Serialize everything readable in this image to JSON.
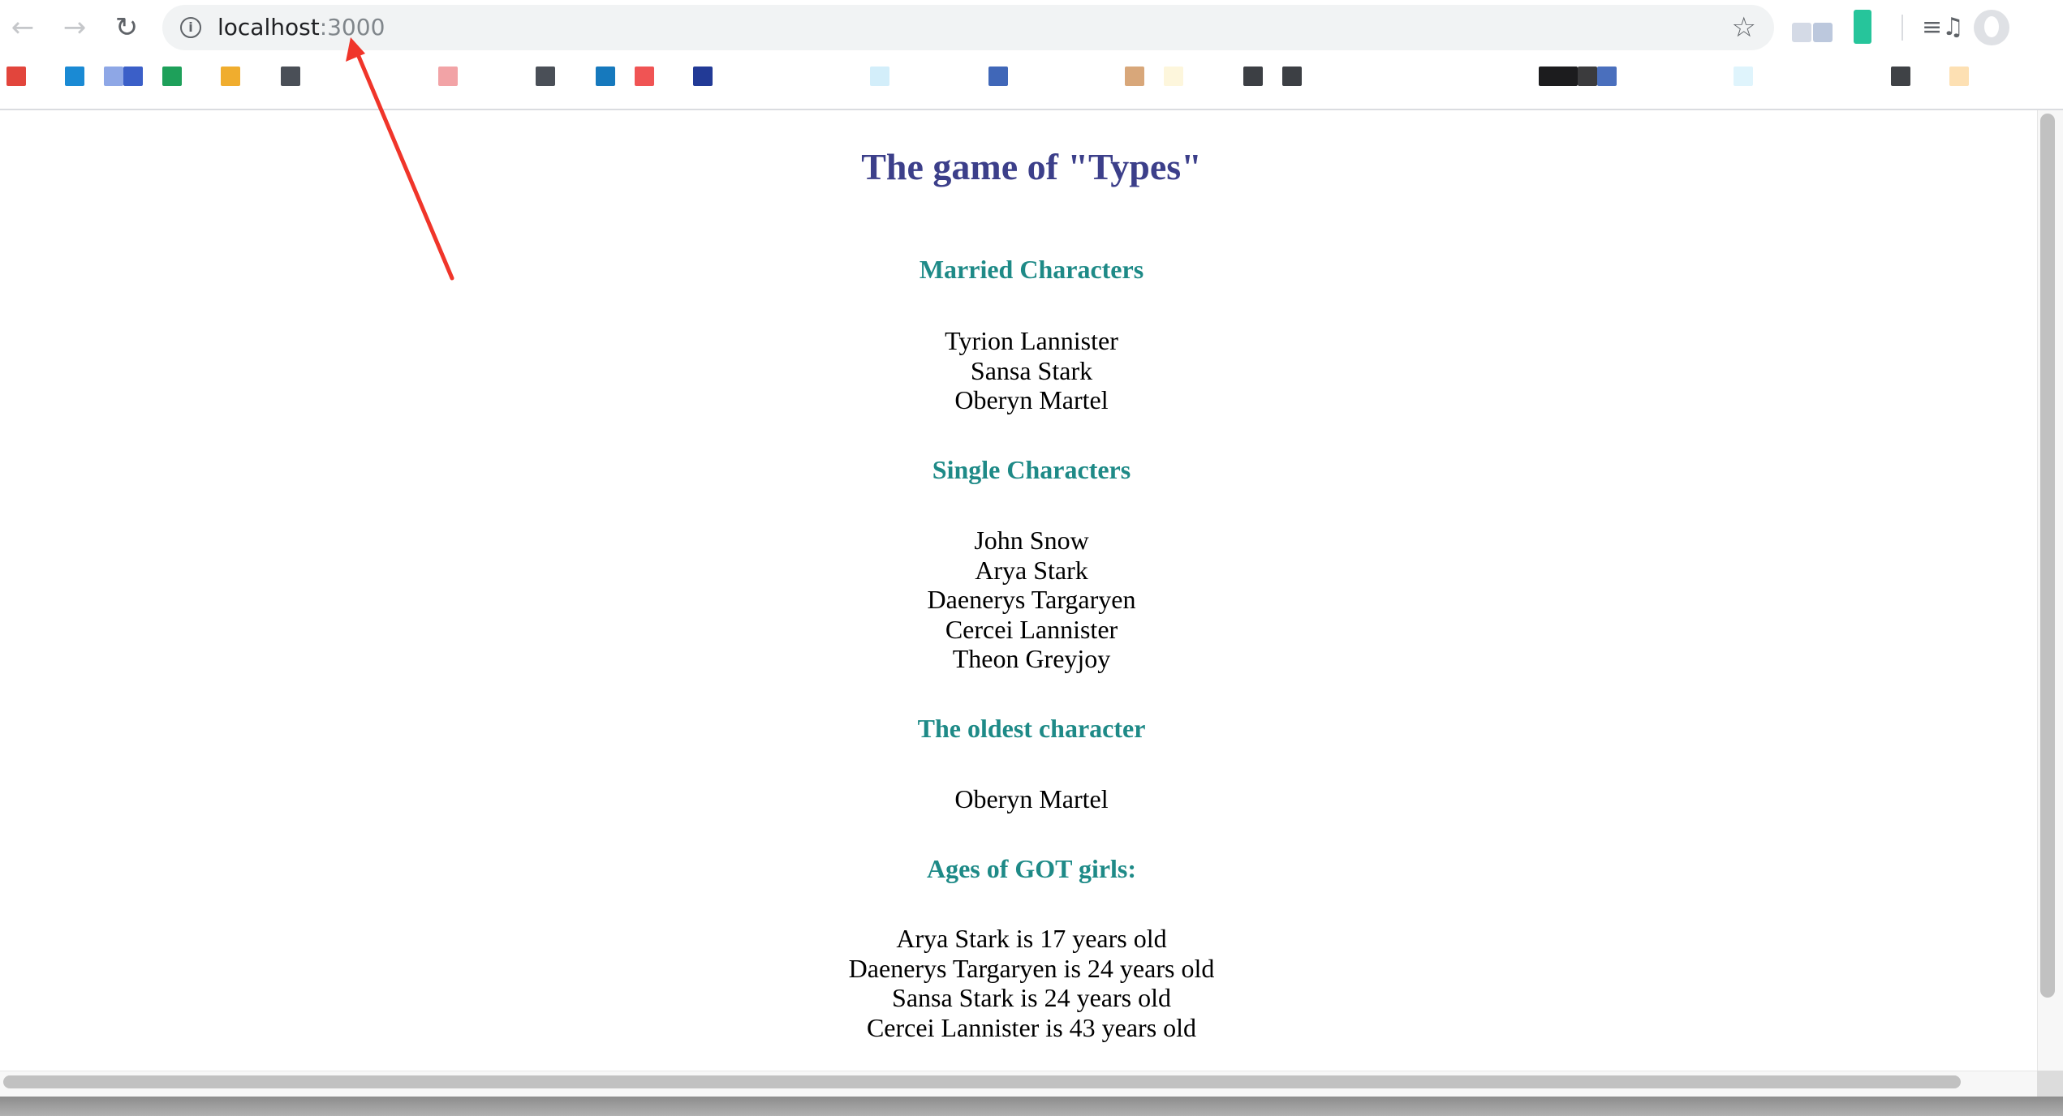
{
  "browser": {
    "back_icon": "arrow-left-icon",
    "forward_icon": "arrow-right-icon",
    "reload_icon": "reload-icon",
    "info_icon": "info-icon",
    "url_host": "localhost",
    "url_port": ":3000",
    "bookmark_star_icon": "star-icon",
    "media_icon": "media-queue-icon",
    "profile_icon": "profile-avatar-icon"
  },
  "page": {
    "title": "The game of \"Types\"",
    "sections": [
      {
        "heading": "Married Characters",
        "items": [
          "Tyrion Lannister",
          "Sansa Stark",
          "Oberyn Martel"
        ]
      },
      {
        "heading": "Single Characters",
        "items": [
          "John Snow",
          "Arya Stark",
          "Daenerys Targaryen",
          "Cercei Lannister",
          "Theon Greyjoy"
        ]
      },
      {
        "heading": "The oldest character",
        "items": [
          "Oberyn Martel"
        ]
      },
      {
        "heading": "Ages of GOT girls:",
        "items": [
          "Arya Stark is 17 years old",
          "Daenerys Targaryen is 24 years old",
          "Sansa Stark is 24 years old",
          "Cercei Lannister is 43 years old"
        ]
      }
    ]
  },
  "colors": {
    "title": "#3c3f8a",
    "section_heading": "#1e8a87",
    "annotation_arrow": "#f0352a"
  }
}
